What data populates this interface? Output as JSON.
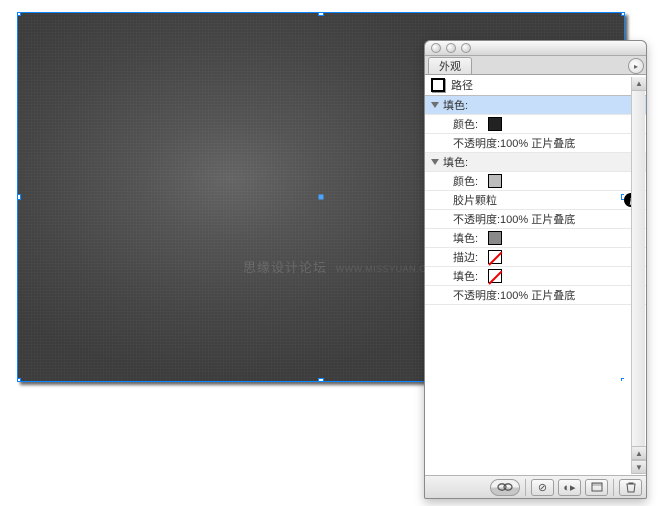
{
  "canvas": {
    "watermark_main": "思缘设计论坛",
    "watermark_sub": "WWW.MISSYUAN.COM"
  },
  "panel": {
    "tab": "外观",
    "object_type": "路径",
    "rows": [
      {
        "kind": "group",
        "label": "填色:",
        "variant": "header"
      },
      {
        "kind": "attr",
        "label": "颜色:",
        "swatch": "#222222"
      },
      {
        "kind": "text",
        "label": "不透明度:100% 正片叠底"
      },
      {
        "kind": "group",
        "label": "填色:",
        "variant": "header2"
      },
      {
        "kind": "attr",
        "label": "颜色:",
        "swatch": "#bdbdbd"
      },
      {
        "kind": "fx",
        "label": "胶片颗粒"
      },
      {
        "kind": "text",
        "label": "不透明度:100% 正片叠底"
      },
      {
        "kind": "attr2",
        "label": "填色:",
        "swatch": "#8a8a8a"
      },
      {
        "kind": "attr2",
        "label": "描边:",
        "swatch": "none"
      },
      {
        "kind": "attr2",
        "label": "填色:",
        "swatch": "none"
      },
      {
        "kind": "text",
        "label": "不透明度:100% 正片叠底"
      }
    ],
    "footer_icons": {
      "new_effect": "fx",
      "clear": "⊘",
      "duplicate": "◐▸",
      "new_fill": "▭",
      "trash": "🗑"
    }
  }
}
